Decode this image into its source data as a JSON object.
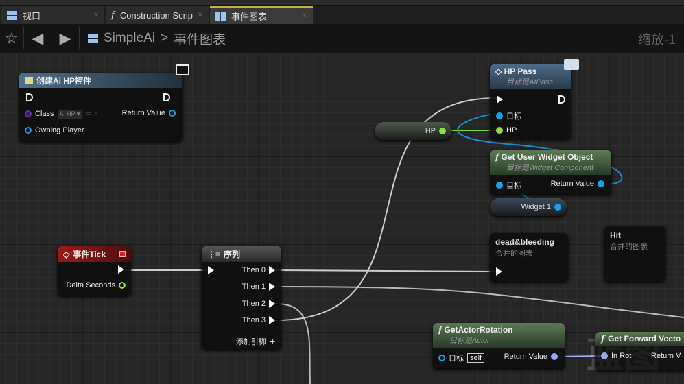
{
  "tabs": [
    {
      "label": "视口",
      "icon": "viewport-grid-icon"
    },
    {
      "label": "Construction Scrip",
      "icon": "function-icon"
    },
    {
      "label": "事件图表",
      "icon": "event-graph-icon",
      "active": true
    }
  ],
  "breadcrumb": {
    "root": "SimpleAi",
    "separator": ">",
    "current": "事件图表"
  },
  "zoom_label": "缩放-1",
  "watermark": "蓝图",
  "nodes": {
    "create_widget": {
      "title": "创建Ai HP控件",
      "class_label": "Class",
      "class_value": "Ai HP",
      "return_label": "Return Value",
      "owning_label": "Owning Player"
    },
    "hp_pass": {
      "title": "HP Pass",
      "subtitle": "目标是AIPass",
      "target_label": "目标",
      "hp_label": "HP"
    },
    "hp_var": {
      "label": "HP"
    },
    "get_user_widget": {
      "title": "Get User Widget Object",
      "subtitle": "目标是Widget Component",
      "target_label": "目标",
      "return_label": "Return Value"
    },
    "widget_var": {
      "label": "Widget 1"
    },
    "dead": {
      "title": "dead&bleeding",
      "subtitle": "合并的图表"
    },
    "hit": {
      "title": "Hit",
      "subtitle": "合并的图表"
    },
    "tick": {
      "title": "事件Tick",
      "delta_label": "Delta Seconds"
    },
    "sequence": {
      "title": "序列",
      "outputs": [
        "Then 0",
        "Then 1",
        "Then 2",
        "Then 3"
      ],
      "add_pin": "添加引脚"
    },
    "get_rotation": {
      "title": "GetActorRotation",
      "subtitle": "目标是Actor",
      "target_label": "目标",
      "self_label": "self",
      "return_label": "Return Value"
    },
    "get_forward": {
      "title": "Get Forward Vecto",
      "in_label": "In Rot",
      "return_label": "Return V"
    }
  },
  "colors": {
    "exec": "#ffffff",
    "float": "#8ee03a",
    "object": "#1aa0e8",
    "class": "#6a2fb0",
    "rotator": "#9aa8f0"
  }
}
